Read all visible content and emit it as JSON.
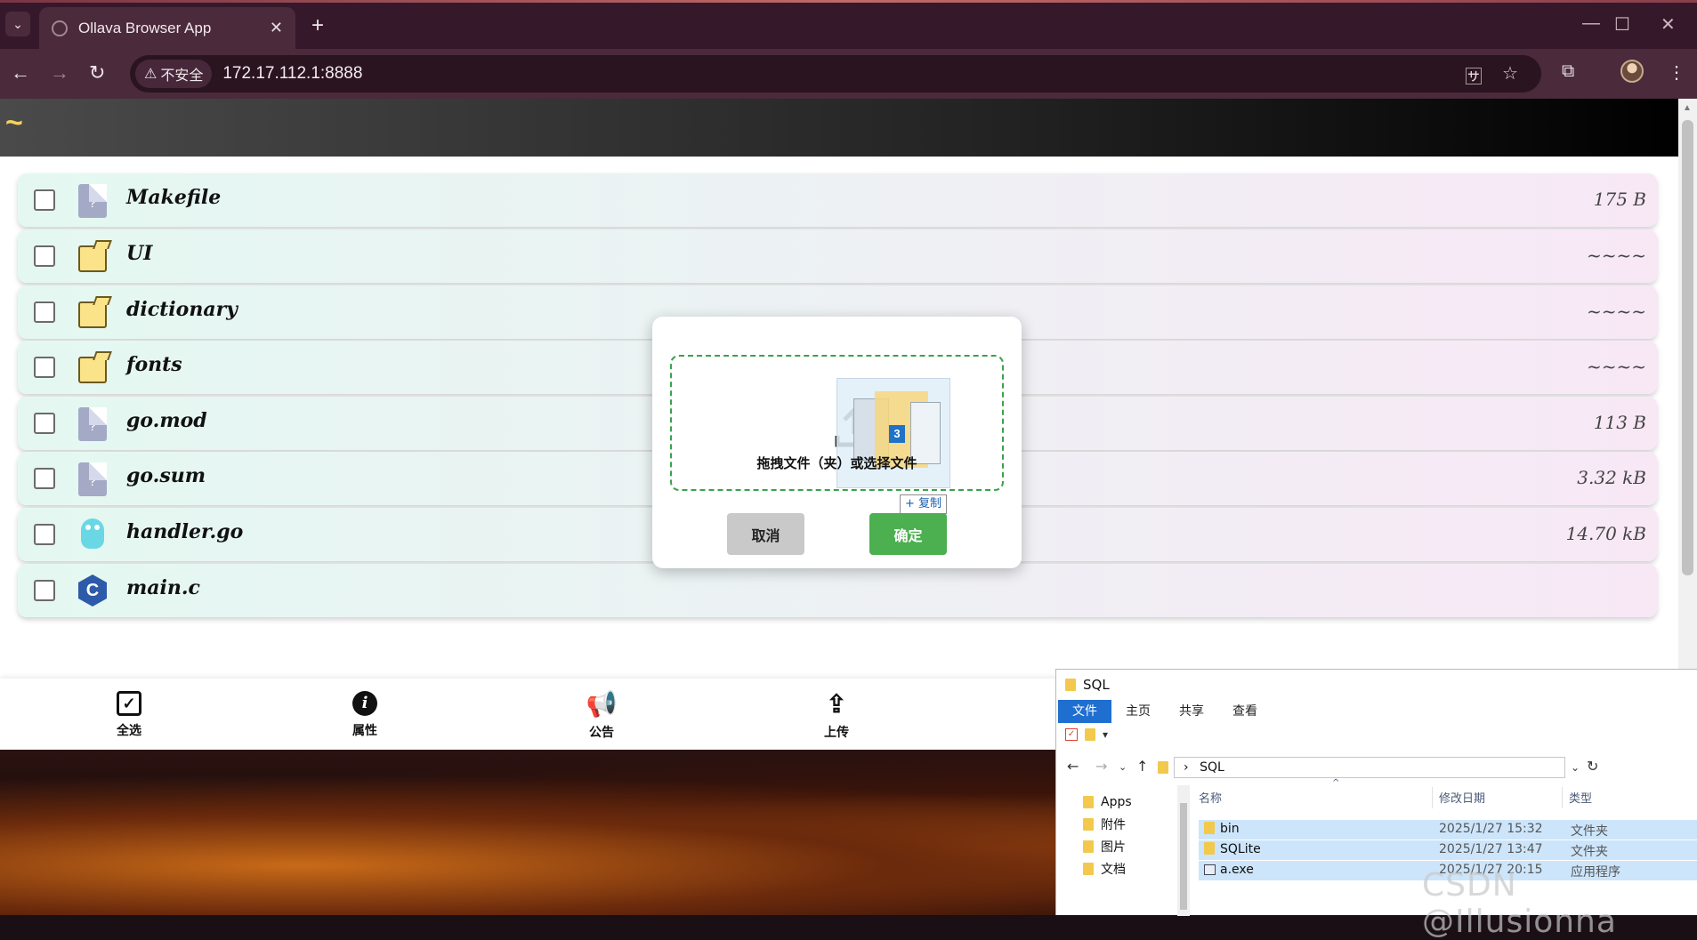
{
  "browser": {
    "tab_title": "Ollava Browser App",
    "tab_close": "✕",
    "new_tab": "+",
    "insecure_label": "不安全",
    "url": "172.17.112.1:8888",
    "window_controls": {
      "minimize": "—",
      "maximize": "☐",
      "close": "✕"
    }
  },
  "app": {
    "home_label": "~",
    "files": [
      {
        "name": "Makefile",
        "size": "175 B",
        "icon": "unknown-file-icon"
      },
      {
        "name": "UI",
        "size": "~~~~",
        "icon": "folder-icon"
      },
      {
        "name": "dictionary",
        "size": "~~~~",
        "icon": "folder-icon"
      },
      {
        "name": "fonts",
        "size": "~~~~",
        "icon": "folder-icon"
      },
      {
        "name": "go.mod",
        "size": "113 B",
        "icon": "unknown-file-icon"
      },
      {
        "name": "go.sum",
        "size": "3.32 kB",
        "icon": "unknown-file-icon"
      },
      {
        "name": "handler.go",
        "size": "14.70 kB",
        "icon": "go-gopher-icon"
      },
      {
        "name": "main.c",
        "size": "",
        "icon": "c-language-icon"
      }
    ],
    "bottom_bar": {
      "select_all": "全选",
      "properties": "属性",
      "announcement": "公告",
      "upload": "上传"
    }
  },
  "upload_dialog": {
    "drop_text": "拖拽文件（夹）或选择文件",
    "drag_badge": "3",
    "copy_tooltip": "+ 复制",
    "cancel_label": "取消",
    "confirm_label": "确定"
  },
  "explorer": {
    "title": "SQL",
    "ribbon": [
      "文件",
      "主页",
      "共享",
      "查看"
    ],
    "path": "SQL",
    "breadcrumb_sep": "›",
    "tree": [
      "Apps",
      "附件",
      "图片",
      "文档"
    ],
    "columns": {
      "name": "名称",
      "modified": "修改日期",
      "type": "类型"
    },
    "files": [
      {
        "name": "bin",
        "date": "2025/1/27 15:32",
        "type": "文件夹"
      },
      {
        "name": "SQLite",
        "date": "2025/1/27 13:47",
        "type": "文件夹"
      },
      {
        "name": "a.exe",
        "date": "2025/1/27 20:15",
        "type": "应用程序"
      }
    ]
  },
  "watermark": "CSDN @Illusionna"
}
